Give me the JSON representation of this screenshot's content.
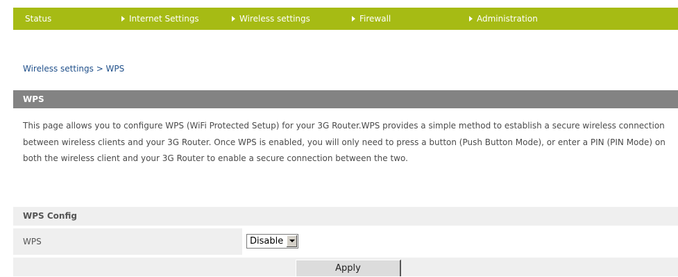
{
  "nav": {
    "items": [
      {
        "label": "Status",
        "arrow": false
      },
      {
        "label": "Internet Settings",
        "arrow": true
      },
      {
        "label": "Wireless settings",
        "arrow": true
      },
      {
        "label": "Firewall",
        "arrow": true
      },
      {
        "label": "Administration",
        "arrow": true
      }
    ],
    "background_color": "#a6bb14",
    "arrow_icon": "triangle-right-icon"
  },
  "breadcrumb": "Wireless settings > WPS",
  "panel": {
    "title": "WPS",
    "description": "This page allows you to configure WPS (WiFi Protected Setup) for your 3G Router.WPS provides a simple method to establish a secure wireless connection between wireless clients and your 3G Router. Once WPS is enabled, you will only need to press a button (Push Button Mode), or enter a PIN (PIN Mode) on both the wireless client and your 3G Router to enable a secure connection between the two.",
    "header_color": "#838383"
  },
  "wps_config": {
    "section_title": "WPS Config",
    "field_label": "WPS",
    "select_value": "Disable",
    "select_icon": "chevron-down-icon"
  },
  "actions": {
    "apply_label": "Apply"
  }
}
